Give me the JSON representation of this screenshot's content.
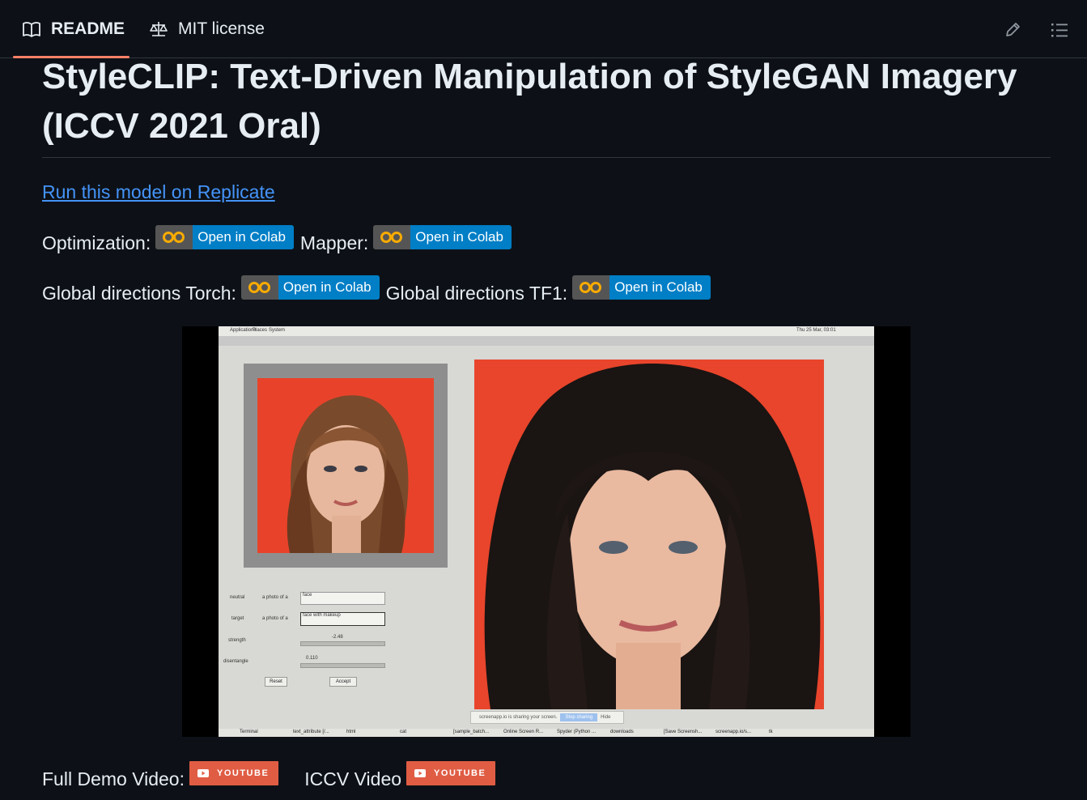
{
  "tabs": {
    "readme": "README",
    "license": "MIT license"
  },
  "readme": {
    "title": "StyleCLIP: Text-Driven Manipulation of StyleGAN Imagery (ICCV 2021 Oral)",
    "replicate_link": "Run this model on Replicate",
    "badge_text": "Open in Colab",
    "optimization_label": "Optimization:",
    "mapper_label": "Mapper:",
    "global_torch_label": "Global directions Torch:",
    "global_tf1_label": "Global directions TF1:",
    "full_demo_label": "Full Demo Video:",
    "iccv_label": "ICCV Video",
    "youtube_badge": "YOUTUBE"
  },
  "demo": {
    "menu_applications": "Applications",
    "menu_places": "Places",
    "menu_system": "System",
    "clock": "Thu 25 Mar, 03:01",
    "neutral_label": "neutral",
    "target_label": "target",
    "photo_of_a": "a photo of a",
    "neutral_value": "face",
    "target_value": "face with makeup",
    "strength_label": "strength",
    "strength_value": "-2.48",
    "disentangle_label": "disentangle",
    "disentangle_value": "0.110",
    "reset": "Reset",
    "accept": "Accept",
    "share_text": "screenapp.io is sharing your screen.",
    "stop_sharing": "Stop sharing",
    "hide": "Hide",
    "taskbar": [
      "Terminal",
      "text_attribute [/...",
      "html",
      "cat",
      "[sample_batch...",
      "Online Screen R...",
      "Spyder (Python ...",
      "downloads",
      "[Save Screensh...",
      "screenapp.io/s...",
      "tk"
    ]
  },
  "colors": {
    "background": "#0d1117",
    "text": "#e6edf3",
    "link": "#4493f8",
    "tab_underline": "#f78166",
    "colab_blue": "#007ec6",
    "youtube_red": "#e05d44"
  }
}
